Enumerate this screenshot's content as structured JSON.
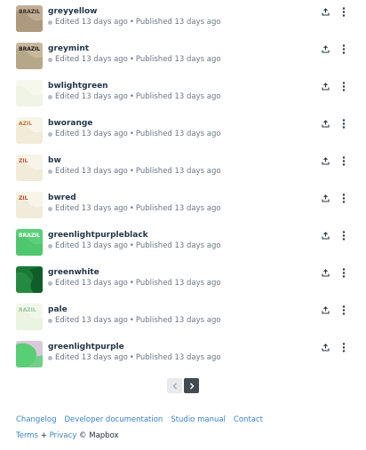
{
  "styles": [
    {
      "name": "greyyellow",
      "status": "Edited 13 days ago",
      "published": "Published 13 days ago",
      "thumb": "greyyellow",
      "thumb_text": "BRAZIL"
    },
    {
      "name": "greymint",
      "status": "Edited 13 days ago",
      "published": "Published 13 days ago",
      "thumb": "greymint",
      "thumb_text": "BRAZIL"
    },
    {
      "name": "bwlightgreen",
      "status": "Edited 13 days ago",
      "published": "Published 13 days ago",
      "thumb": "bwlightgreen",
      "thumb_text": ""
    },
    {
      "name": "bworange",
      "status": "Edited 13 days ago",
      "published": "Published 13 days ago",
      "thumb": "bworange",
      "thumb_text": "AZIL"
    },
    {
      "name": "bw",
      "status": "Edited 13 days ago",
      "published": "Published 13 days ago",
      "thumb": "bw",
      "thumb_text": "ZIL"
    },
    {
      "name": "bwred",
      "status": "Edited 13 days ago",
      "published": "Published 13 days ago",
      "thumb": "bwred",
      "thumb_text": "ZIL"
    },
    {
      "name": "greenlightpurpleblack",
      "status": "Edited 13 days ago",
      "published": "Published 13 days ago",
      "thumb": "greenlightpurpleblack",
      "thumb_text": "BRAZIL"
    },
    {
      "name": "greenwhite",
      "status": "Edited 13 days ago",
      "published": "Published 13 days ago",
      "thumb": "greenwhite",
      "thumb_text": ""
    },
    {
      "name": "pale",
      "status": "Edited 13 days ago",
      "published": "Published 13 days ago",
      "thumb": "pale",
      "thumb_text": "RAZIL"
    },
    {
      "name": "greenlightpurple",
      "status": "Edited 13 days ago",
      "published": "Published 13 days ago",
      "thumb": "greenlightpurple",
      "thumb_text": ""
    }
  ],
  "row_actions": {
    "share_icon": "share-icon",
    "more_icon": "more-vertical-icon"
  },
  "pagination": {
    "prev_icon": "chevron-left-icon",
    "next_icon": "chevron-right-icon"
  },
  "footer": {
    "links": [
      "Changelog",
      "Developer documentation",
      "Studio manual",
      "Contact"
    ],
    "terms": "Terms",
    "plus": " + ",
    "privacy": "Privacy",
    "copyright": " © Mapbox"
  },
  "colors": {
    "link": "#3b82c4",
    "text": "#243447",
    "muted": "#6b7785"
  }
}
